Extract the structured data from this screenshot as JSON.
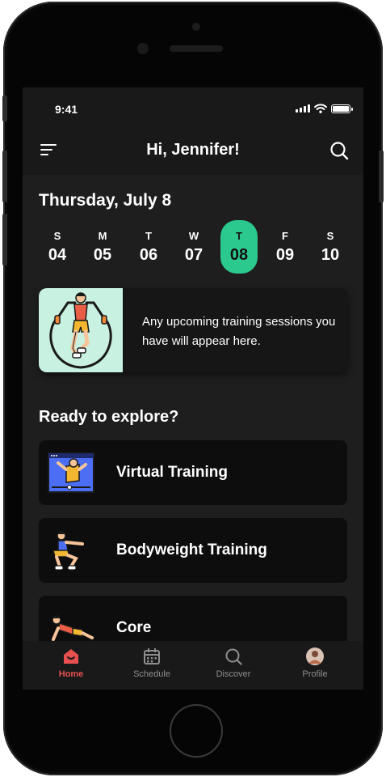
{
  "status_bar": {
    "time": "9:41"
  },
  "header": {
    "greeting": "Hi, Jennifer!"
  },
  "date_heading": "Thursday, July 8",
  "week": [
    {
      "letter": "S",
      "num": "04",
      "active": false
    },
    {
      "letter": "M",
      "num": "05",
      "active": false
    },
    {
      "letter": "T",
      "num": "06",
      "active": false
    },
    {
      "letter": "W",
      "num": "07",
      "active": false
    },
    {
      "letter": "T",
      "num": "08",
      "active": true
    },
    {
      "letter": "F",
      "num": "09",
      "active": false
    },
    {
      "letter": "S",
      "num": "10",
      "active": false
    }
  ],
  "session_card": {
    "message": "Any upcoming training sessions you have will appear here."
  },
  "explore": {
    "heading": "Ready to explore?",
    "items": [
      {
        "label": "Virtual Training",
        "icon": "virtual-training-icon"
      },
      {
        "label": "Bodyweight Training",
        "icon": "bodyweight-training-icon"
      },
      {
        "label": "Core",
        "icon": "core-training-icon"
      }
    ]
  },
  "tabs": [
    {
      "label": "Home",
      "icon": "home-icon",
      "active": true
    },
    {
      "label": "Schedule",
      "icon": "calendar-icon",
      "active": false
    },
    {
      "label": "Discover",
      "icon": "search-icon",
      "active": false
    },
    {
      "label": "Profile",
      "icon": "avatar",
      "active": false
    }
  ],
  "colors": {
    "accent_green": "#2cc98e",
    "accent_red": "#e6504f",
    "illustration_bg": "#c8f1e1",
    "background": "#1e1e1e"
  }
}
